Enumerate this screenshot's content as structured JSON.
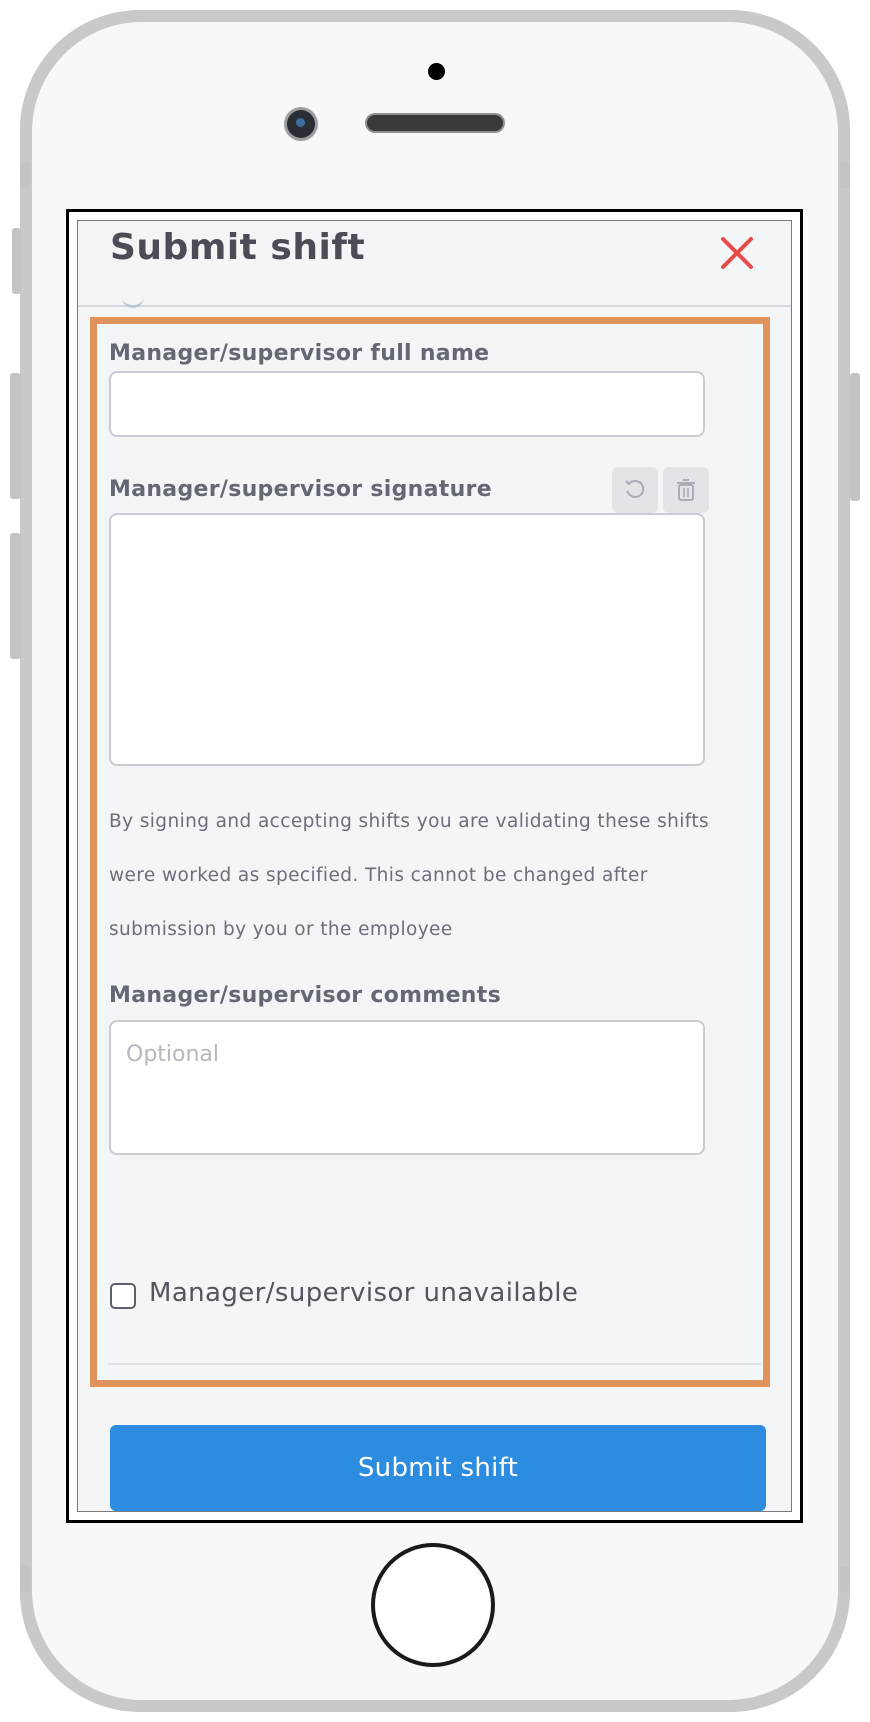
{
  "modal": {
    "title": "Submit shift"
  },
  "form": {
    "name_label": "Manager/supervisor full name",
    "name_value": "",
    "signature_label": "Manager/supervisor signature",
    "disclaimer": "By signing and accepting shifts you are validating these shifts were worked as specified. This cannot be changed after submission by you or the employee",
    "comments_label": "Manager/supervisor comments",
    "comments_placeholder": "Optional",
    "unavailable_label": "Manager/supervisor unavailable",
    "unavailable_checked": false
  },
  "actions": {
    "submit_label": "Submit shift"
  },
  "colors": {
    "accent": "#2b8ce0",
    "close": "#e84a4a",
    "highlight": "#e0935a"
  }
}
